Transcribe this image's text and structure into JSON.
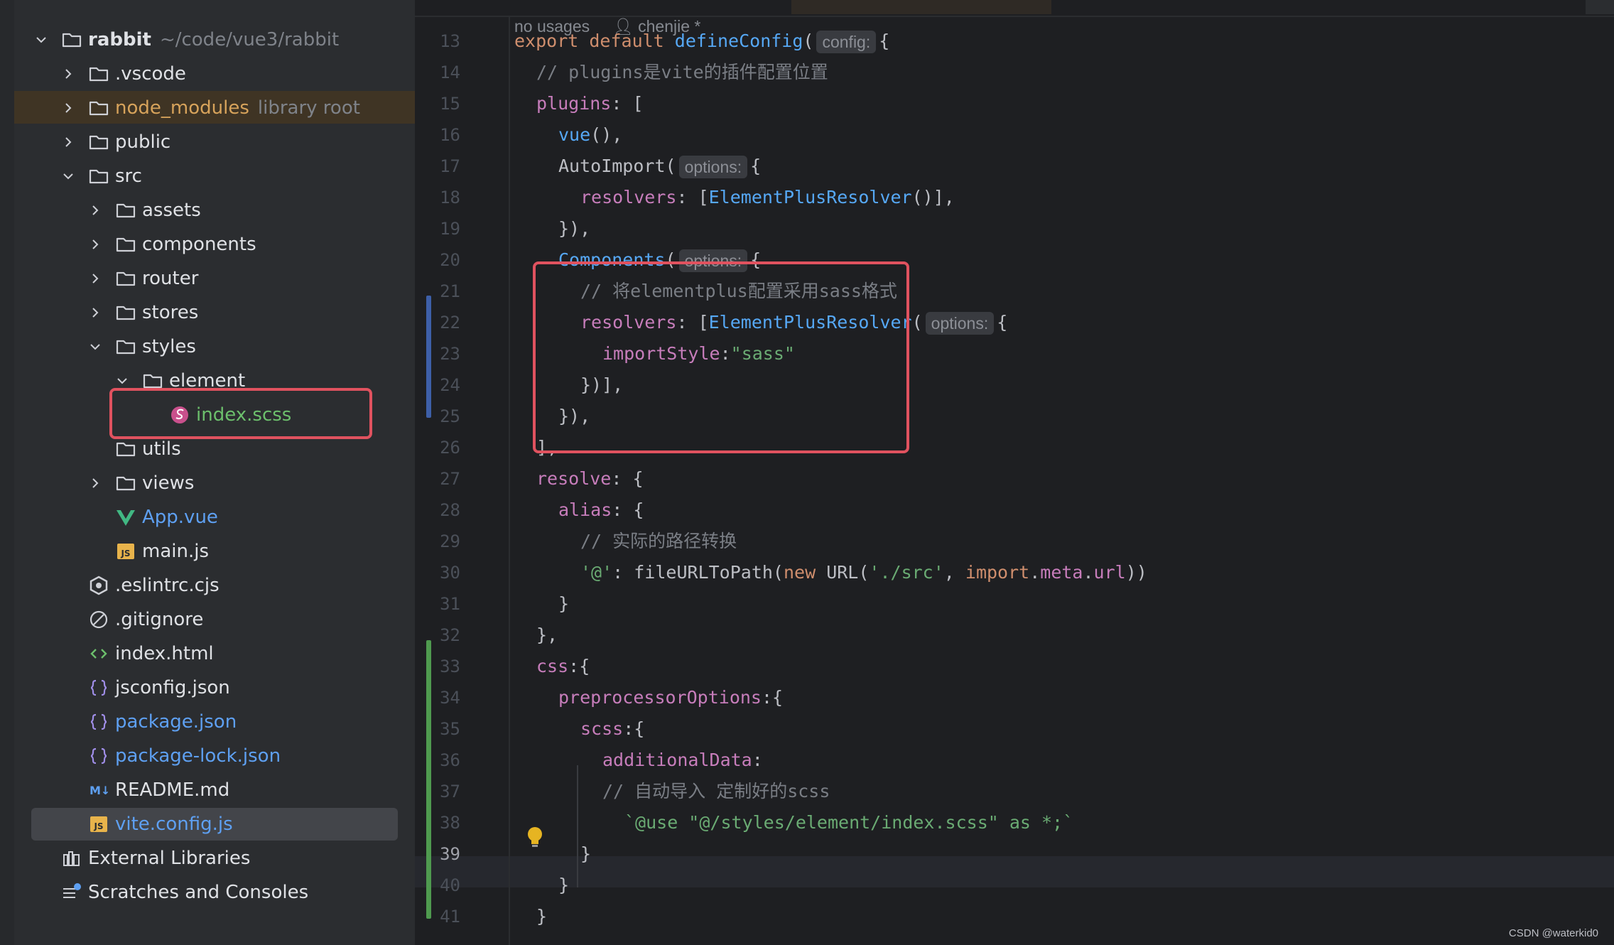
{
  "tree": {
    "items": [
      {
        "label": "rabbit",
        "note": "~/code/vue3/rabbit",
        "depth": 0,
        "chevron": "down",
        "icon": "folder-icon",
        "style": "bold"
      },
      {
        "label": ".vscode",
        "depth": 1,
        "chevron": "right",
        "icon": "folder-icon",
        "style": "normal"
      },
      {
        "label": "node_modules",
        "note": "library root",
        "depth": 1,
        "chevron": "right",
        "icon": "folder-icon",
        "style": "orange"
      },
      {
        "label": "public",
        "depth": 1,
        "chevron": "right",
        "icon": "folder-icon",
        "style": "normal"
      },
      {
        "label": "src",
        "depth": 1,
        "chevron": "down",
        "icon": "folder-icon",
        "style": "normal"
      },
      {
        "label": "assets",
        "depth": 2,
        "chevron": "right",
        "icon": "folder-icon",
        "style": "normal"
      },
      {
        "label": "components",
        "depth": 2,
        "chevron": "right",
        "icon": "folder-icon",
        "style": "normal"
      },
      {
        "label": "router",
        "depth": 2,
        "chevron": "right",
        "icon": "folder-icon",
        "style": "normal"
      },
      {
        "label": "stores",
        "depth": 2,
        "chevron": "right",
        "icon": "folder-icon",
        "style": "normal"
      },
      {
        "label": "styles",
        "depth": 2,
        "chevron": "down",
        "icon": "folder-icon",
        "style": "normal"
      },
      {
        "label": "element",
        "depth": 3,
        "chevron": "down",
        "icon": "folder-icon",
        "style": "normal"
      },
      {
        "label": "index.scss",
        "depth": 4,
        "chevron": "none",
        "icon": "sass-icon",
        "style": "green"
      },
      {
        "label": "utils",
        "depth": 2,
        "chevron": "none",
        "icon": "folder-icon",
        "style": "normal"
      },
      {
        "label": "views",
        "depth": 2,
        "chevron": "right",
        "icon": "folder-icon",
        "style": "normal"
      },
      {
        "label": "App.vue",
        "depth": 2,
        "chevron": "none",
        "icon": "vue-icon",
        "style": "blue"
      },
      {
        "label": "main.js",
        "depth": 2,
        "chevron": "none",
        "icon": "js-icon",
        "style": "normal"
      },
      {
        "label": ".eslintrc.cjs",
        "depth": 1,
        "chevron": "none",
        "icon": "eslint-icon",
        "style": "normal"
      },
      {
        "label": ".gitignore",
        "depth": 1,
        "chevron": "none",
        "icon": "ignore-icon",
        "style": "normal"
      },
      {
        "label": "index.html",
        "depth": 1,
        "chevron": "none",
        "icon": "html-icon",
        "style": "normal"
      },
      {
        "label": "jsconfig.json",
        "depth": 1,
        "chevron": "none",
        "icon": "json-icon",
        "style": "normal"
      },
      {
        "label": "package.json",
        "depth": 1,
        "chevron": "none",
        "icon": "json-icon",
        "style": "blue"
      },
      {
        "label": "package-lock.json",
        "depth": 1,
        "chevron": "none",
        "icon": "json-icon",
        "style": "blue"
      },
      {
        "label": "README.md",
        "depth": 1,
        "chevron": "none",
        "icon": "markdown-icon",
        "style": "normal"
      },
      {
        "label": "vite.config.js",
        "depth": 1,
        "chevron": "none",
        "icon": "js-icon",
        "style": "blue",
        "selected": true
      },
      {
        "label": "External Libraries",
        "depth": 0,
        "chevron": "none",
        "icon": "library-icon",
        "style": "normal"
      },
      {
        "label": "Scratches and Consoles",
        "depth": 0,
        "chevron": "none",
        "icon": "scratches-icon",
        "style": "normal"
      }
    ]
  },
  "editor": {
    "usages": "no usages",
    "author": "chenjie *",
    "current_line": 39,
    "lines": [
      {
        "n": 13,
        "tokens": [
          [
            "kw",
            "export default "
          ],
          [
            "fn",
            "defineConfig"
          ],
          [
            "plain",
            "("
          ],
          [
            "inlay",
            "config:"
          ],
          [
            "plain",
            "{"
          ]
        ]
      },
      {
        "n": 14,
        "indent": 1,
        "tokens": [
          [
            "cm",
            "// plugins是vite的插件配置位置"
          ]
        ]
      },
      {
        "n": 15,
        "indent": 1,
        "tokens": [
          [
            "prop",
            "plugins"
          ],
          [
            "plain",
            ": ["
          ]
        ]
      },
      {
        "n": 16,
        "indent": 2,
        "tokens": [
          [
            "fn",
            "vue"
          ],
          [
            "plain",
            "(),"
          ]
        ]
      },
      {
        "n": 17,
        "indent": 2,
        "tokens": [
          [
            "plain",
            "AutoImport("
          ],
          [
            "inlay",
            "options:"
          ],
          [
            "plain",
            "{"
          ]
        ]
      },
      {
        "n": 18,
        "indent": 3,
        "tokens": [
          [
            "prop",
            "resolvers"
          ],
          [
            "plain",
            ": ["
          ],
          [
            "fn",
            "ElementPlusResolver"
          ],
          [
            "plain",
            "()],"
          ]
        ]
      },
      {
        "n": 19,
        "indent": 2,
        "tokens": [
          [
            "plain",
            "}),"
          ]
        ]
      },
      {
        "n": 20,
        "indent": 2,
        "tokens": [
          [
            "fn",
            "Components"
          ],
          [
            "plain",
            "("
          ],
          [
            "inlay",
            "options:"
          ],
          [
            "plain",
            "{"
          ]
        ]
      },
      {
        "n": 21,
        "indent": 3,
        "tokens": [
          [
            "cm",
            "// 将elementplus配置采用sass格式"
          ]
        ]
      },
      {
        "n": 22,
        "indent": 3,
        "tokens": [
          [
            "prop",
            "resolvers"
          ],
          [
            "plain",
            ": ["
          ],
          [
            "fn",
            "ElementPlusResolver"
          ],
          [
            "plain",
            "("
          ],
          [
            "inlay",
            "options:"
          ],
          [
            "plain",
            "{"
          ]
        ]
      },
      {
        "n": 23,
        "indent": 4,
        "tokens": [
          [
            "prop",
            "importStyle"
          ],
          [
            "plain",
            ":"
          ],
          [
            "str",
            "\"sass\""
          ]
        ]
      },
      {
        "n": 24,
        "indent": 3,
        "tokens": [
          [
            "plain",
            "})],"
          ]
        ]
      },
      {
        "n": 25,
        "indent": 2,
        "tokens": [
          [
            "plain",
            "}),"
          ]
        ]
      },
      {
        "n": 26,
        "indent": 1,
        "tokens": [
          [
            "plain",
            "],"
          ]
        ]
      },
      {
        "n": 27,
        "indent": 1,
        "tokens": [
          [
            "prop",
            "resolve"
          ],
          [
            "plain",
            ": {"
          ]
        ]
      },
      {
        "n": 28,
        "indent": 2,
        "tokens": [
          [
            "prop",
            "alias"
          ],
          [
            "plain",
            ": {"
          ]
        ]
      },
      {
        "n": 29,
        "indent": 3,
        "tokens": [
          [
            "cm",
            "// 实际的路径转换"
          ]
        ]
      },
      {
        "n": 30,
        "indent": 3,
        "tokens": [
          [
            "str",
            "'@'"
          ],
          [
            "plain",
            ": fileURLToPath("
          ],
          [
            "kw",
            "new "
          ],
          [
            "plain",
            "URL("
          ],
          [
            "str",
            "'./src'"
          ],
          [
            "plain",
            ", "
          ],
          [
            "kw",
            "import"
          ],
          [
            "plain",
            "."
          ],
          [
            "prop",
            "meta"
          ],
          [
            "plain",
            "."
          ],
          [
            "prop",
            "url"
          ],
          [
            "plain",
            "))"
          ]
        ]
      },
      {
        "n": 31,
        "indent": 2,
        "tokens": [
          [
            "plain",
            "}"
          ]
        ]
      },
      {
        "n": 32,
        "indent": 1,
        "tokens": [
          [
            "plain",
            "},"
          ]
        ]
      },
      {
        "n": 33,
        "indent": 1,
        "tokens": [
          [
            "prop",
            "css"
          ],
          [
            "plain",
            ":{"
          ]
        ]
      },
      {
        "n": 34,
        "indent": 2,
        "tokens": [
          [
            "prop",
            "preprocessorOptions"
          ],
          [
            "plain",
            ":{"
          ]
        ]
      },
      {
        "n": 35,
        "indent": 3,
        "tokens": [
          [
            "prop",
            "scss"
          ],
          [
            "plain",
            ":{"
          ]
        ]
      },
      {
        "n": 36,
        "indent": 4,
        "tokens": [
          [
            "prop",
            "additionalData"
          ],
          [
            "plain",
            ":"
          ]
        ]
      },
      {
        "n": 37,
        "indent": 4,
        "tokens": [
          [
            "cm",
            "// 自动导入 定制好的scss"
          ]
        ]
      },
      {
        "n": 38,
        "indent": 5,
        "tokens": [
          [
            "str",
            "`@use \"@/styles/element/index.scss\" as *;`"
          ]
        ]
      },
      {
        "n": 39,
        "indent": 3,
        "tokens": [
          [
            "plain",
            "}"
          ]
        ]
      },
      {
        "n": 40,
        "indent": 2,
        "tokens": [
          [
            "plain",
            "}"
          ]
        ]
      },
      {
        "n": 41,
        "indent": 1,
        "tokens": [
          [
            "plain",
            "}"
          ]
        ]
      }
    ]
  },
  "watermark": "CSDN @waterkid0",
  "colors": {
    "highlight_box": "#e0525f",
    "vcs_modified": "#3d5fa8",
    "vcs_added": "#4f9a4f"
  }
}
